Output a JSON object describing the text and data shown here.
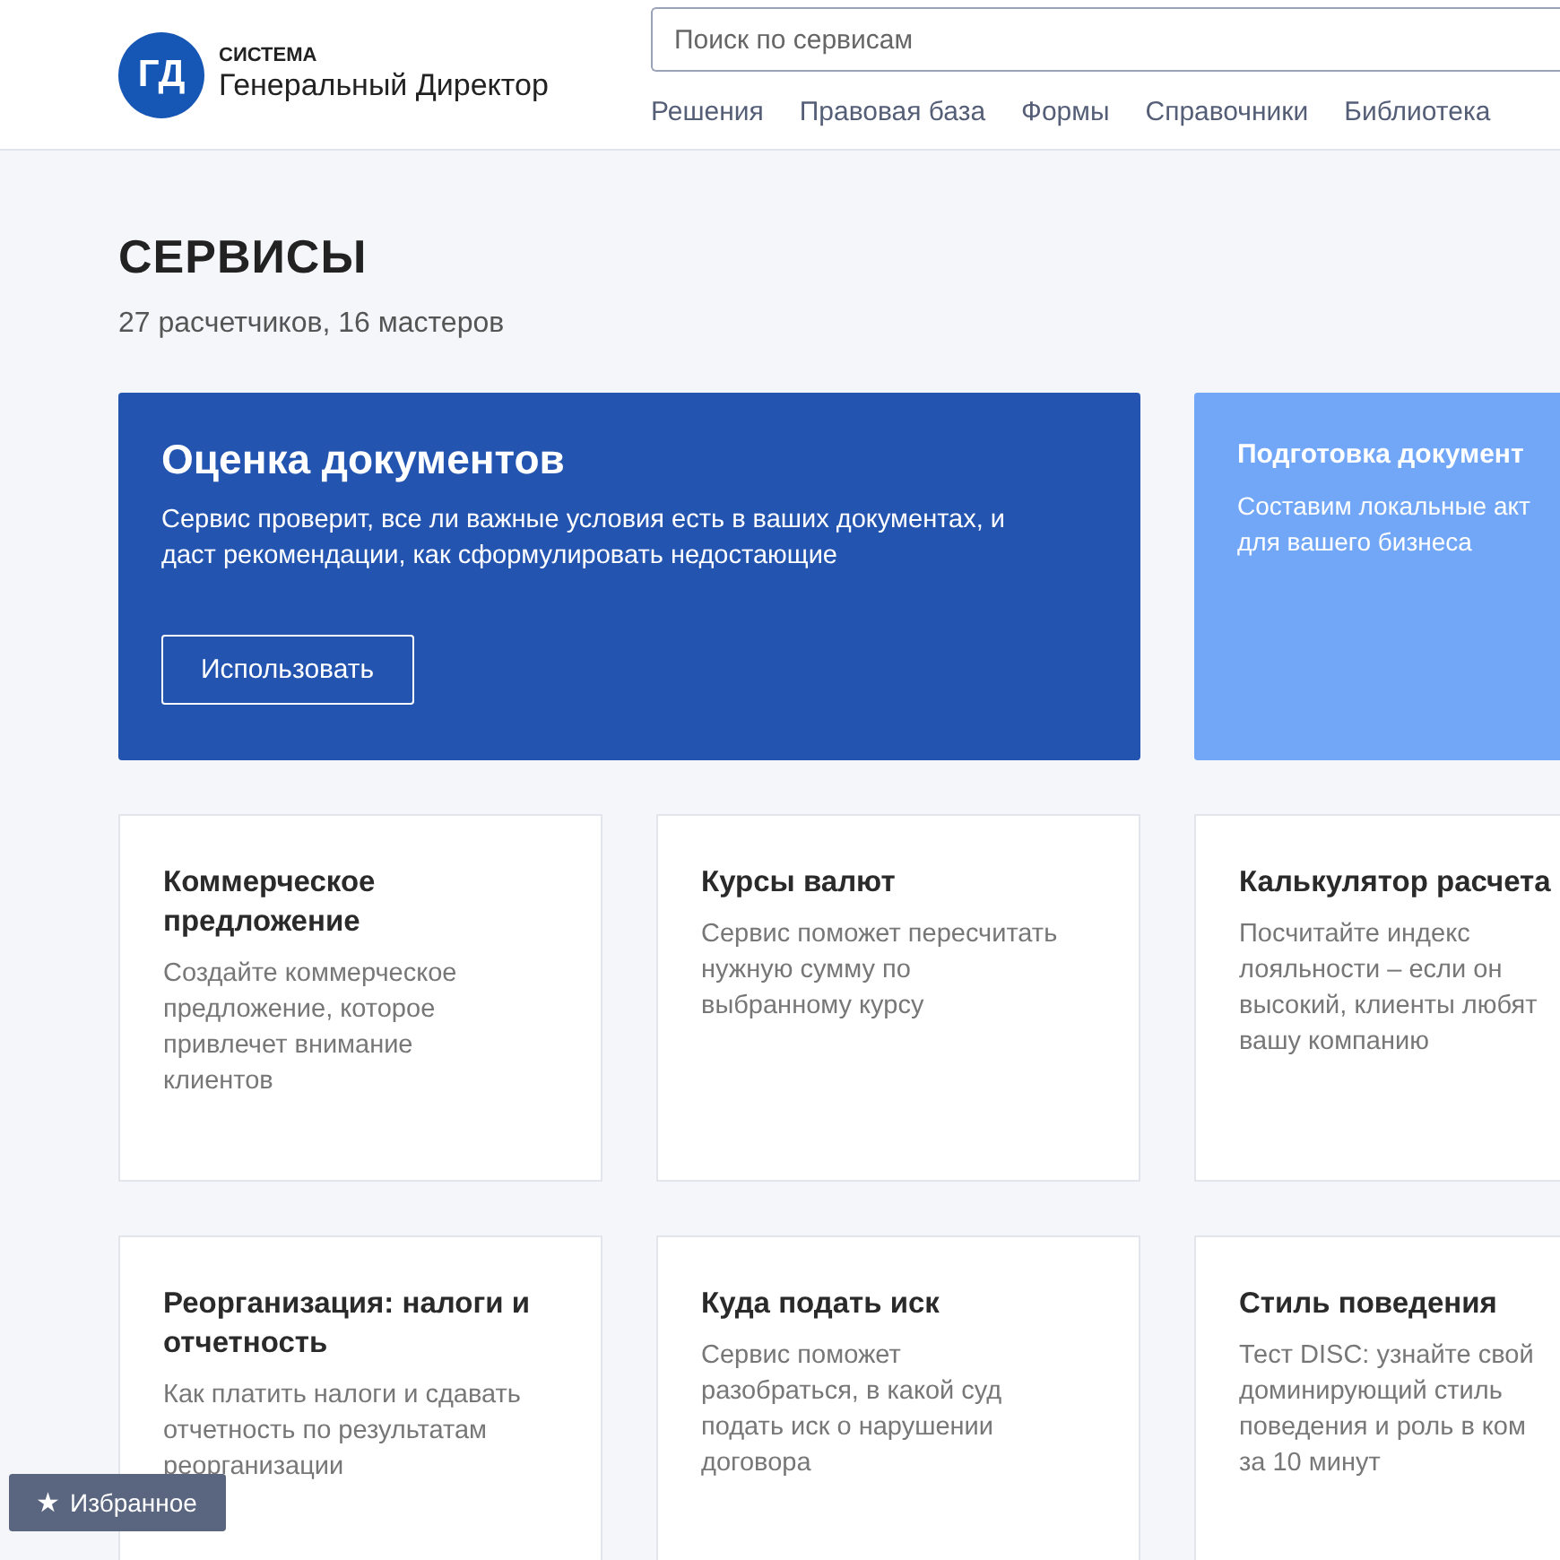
{
  "header": {
    "logo": {
      "mark": "ГД",
      "system": "СИСТЕМА",
      "name": "Генеральный Директор"
    },
    "search": {
      "placeholder": "Поиск по сервисам"
    },
    "nav": [
      "Решения",
      "Правовая база",
      "Формы",
      "Справочники",
      "Библиотека"
    ]
  },
  "page": {
    "title": "СЕРВИСЫ",
    "subtitle": "27 расчетчиков, 16 мастеров"
  },
  "featured": [
    {
      "kind": "dark",
      "title": "Оценка документов",
      "description": [
        "Сервис проверит, все ли важные условия есть в ваших документах, и",
        "даст рекомендации, как сформулировать недостающие"
      ],
      "button": "Использовать"
    },
    {
      "kind": "light",
      "title": "Подготовка документ",
      "description": [
        "Составим локальные акт",
        "для вашего бизнеса"
      ]
    }
  ],
  "services": [
    {
      "title": [
        "Коммерческое",
        "предложение"
      ],
      "description": [
        "Создайте коммерческое",
        "предложение, которое",
        "привлечет внимание",
        "клиентов"
      ]
    },
    {
      "title": [
        "Курсы валют"
      ],
      "description": [
        "Сервис поможет пересчитать",
        "нужную сумму по",
        "выбранному курсу"
      ]
    },
    {
      "title": [
        "Калькулятор расчета"
      ],
      "description": [
        "Посчитайте индекс",
        "лояльности – если он",
        "высокий, клиенты любят",
        "вашу компанию"
      ]
    },
    {
      "title": [
        "Реорганизация: налоги и",
        "отчетность"
      ],
      "description": [
        "Как платить налоги и сдавать",
        "отчетность по результатам",
        "реорганизации"
      ]
    },
    {
      "title": [
        "Куда подать иск"
      ],
      "description": [
        "Сервис поможет",
        "разобраться, в какой суд",
        "подать иск о нарушении",
        "договора"
      ]
    },
    {
      "title": [
        "Стиль поведения"
      ],
      "description": [
        "Тест DISC: узнайте свой",
        "доминирующий стиль",
        "поведения и роль в ком",
        "за 10 минут"
      ]
    }
  ],
  "favorites_button": {
    "icon": "★",
    "label": "Избранное"
  }
}
